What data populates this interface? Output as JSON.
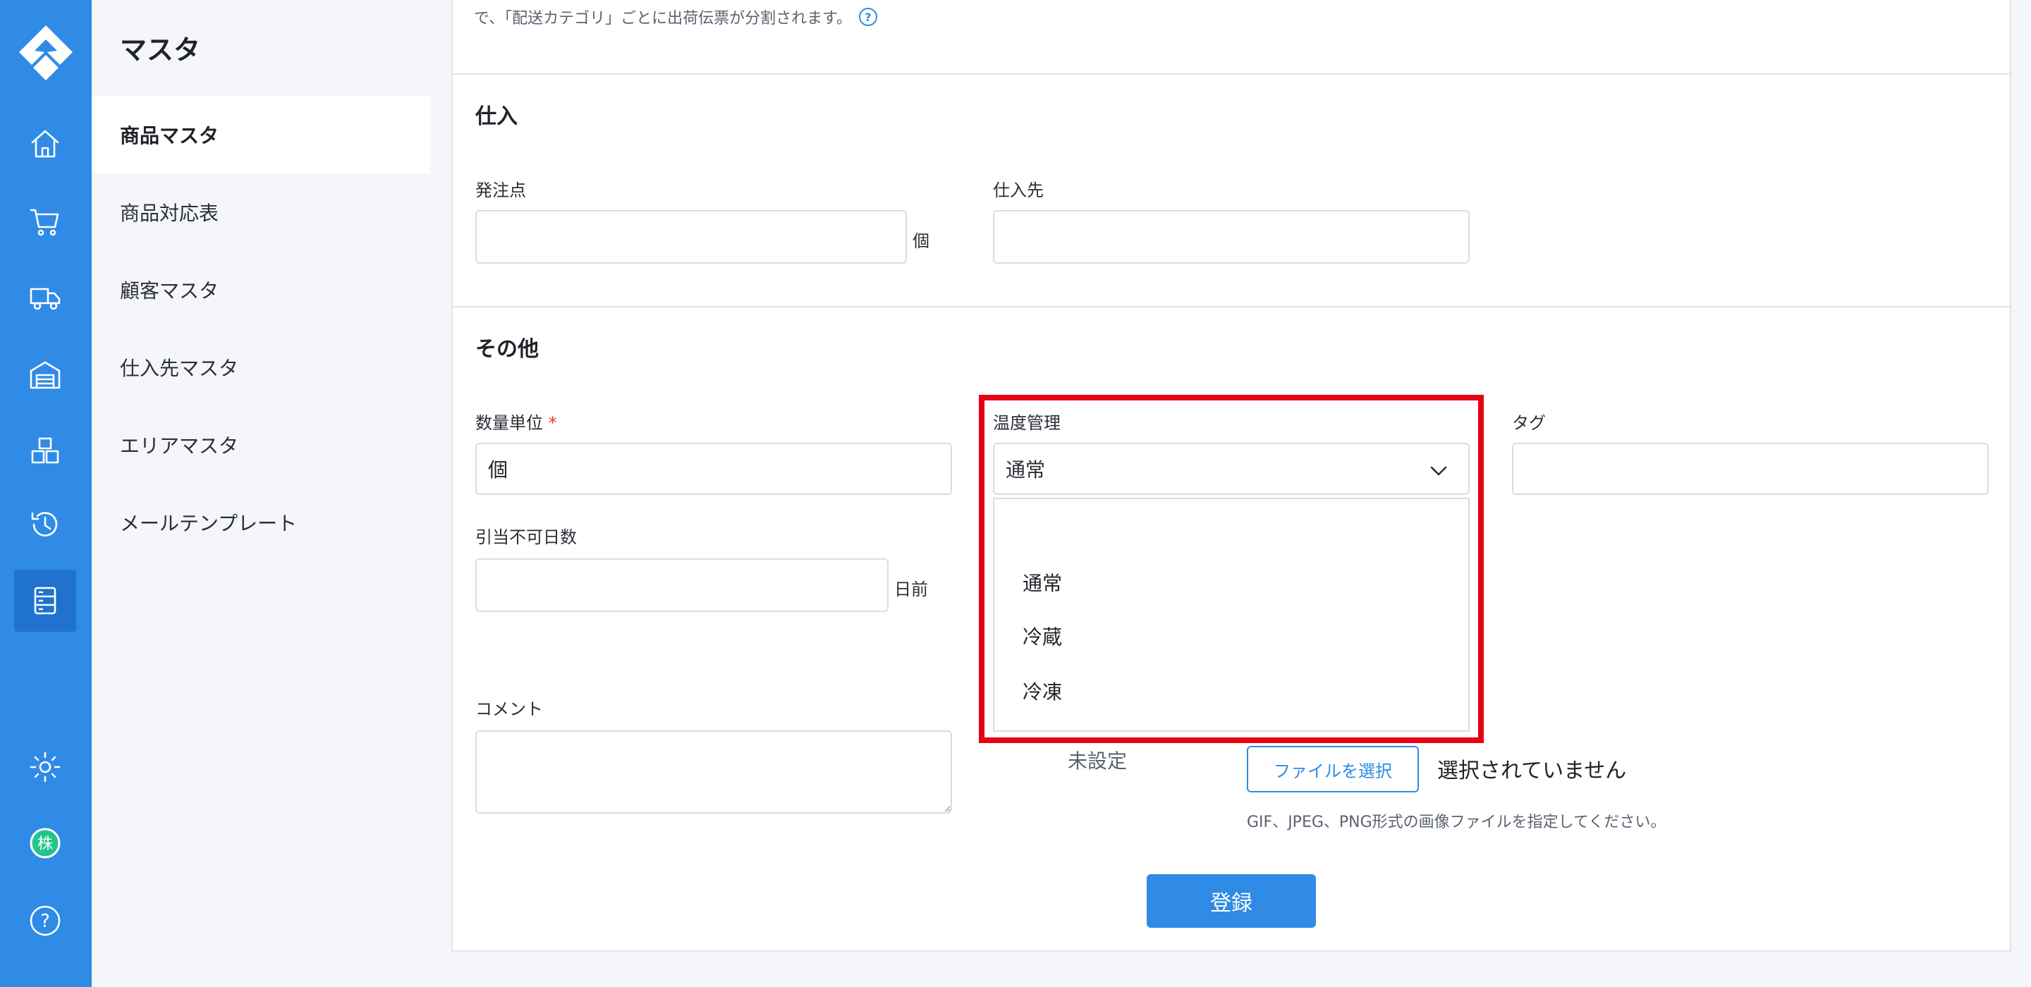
{
  "app": {
    "logo_icon": "app-logo-icon",
    "accent_color": "#2f8be6",
    "highlight_color": "#e60012"
  },
  "rail": {
    "items": [
      {
        "icon": "home-icon"
      },
      {
        "icon": "cart-icon"
      },
      {
        "icon": "truck-icon"
      },
      {
        "icon": "warehouse-icon"
      },
      {
        "icon": "boxes-icon"
      },
      {
        "icon": "history-icon"
      },
      {
        "icon": "master-list-icon",
        "active": true
      }
    ],
    "bottom": [
      {
        "icon": "gear-icon"
      },
      {
        "icon": "company-badge-icon",
        "label": "株"
      },
      {
        "icon": "help-icon",
        "label": "?"
      }
    ]
  },
  "sidebar": {
    "title": "マスタ",
    "items": [
      {
        "label": "商品マスタ",
        "active": true
      },
      {
        "label": "商品対応表"
      },
      {
        "label": "顧客マスタ"
      },
      {
        "label": "仕入先マスタ"
      },
      {
        "label": "エリアマスタ"
      },
      {
        "label": "メールテンプレート"
      }
    ]
  },
  "main": {
    "intro_text": "で、「配送カテゴリ」ごとに出荷伝票が分割されます。",
    "intro_help": "?",
    "purchase": {
      "title": "仕入",
      "reorder_point_label": "発注点",
      "reorder_point_value": "",
      "reorder_point_unit": "個",
      "supplier_label": "仕入先",
      "supplier_value": ""
    },
    "other": {
      "title": "その他",
      "unit_label": "数量単位",
      "required_mark": "*",
      "unit_value": "個",
      "temp_label": "温度管理",
      "temp_selected": "通常",
      "temp_options": [
        "通常",
        "冷蔵",
        "冷凍"
      ],
      "tag_label": "タグ",
      "tag_value": "",
      "no_alloc_label": "引当不可日数",
      "no_alloc_value": "",
      "no_alloc_unit": "日前",
      "comment_label": "コメント",
      "comment_value": "",
      "image_status": "未設定",
      "file_button": "ファイルを選択",
      "file_status": "選択されていません",
      "file_hint": "GIF、JPEG、PNG形式の画像ファイルを指定してください。"
    },
    "submit_label": "登録"
  }
}
